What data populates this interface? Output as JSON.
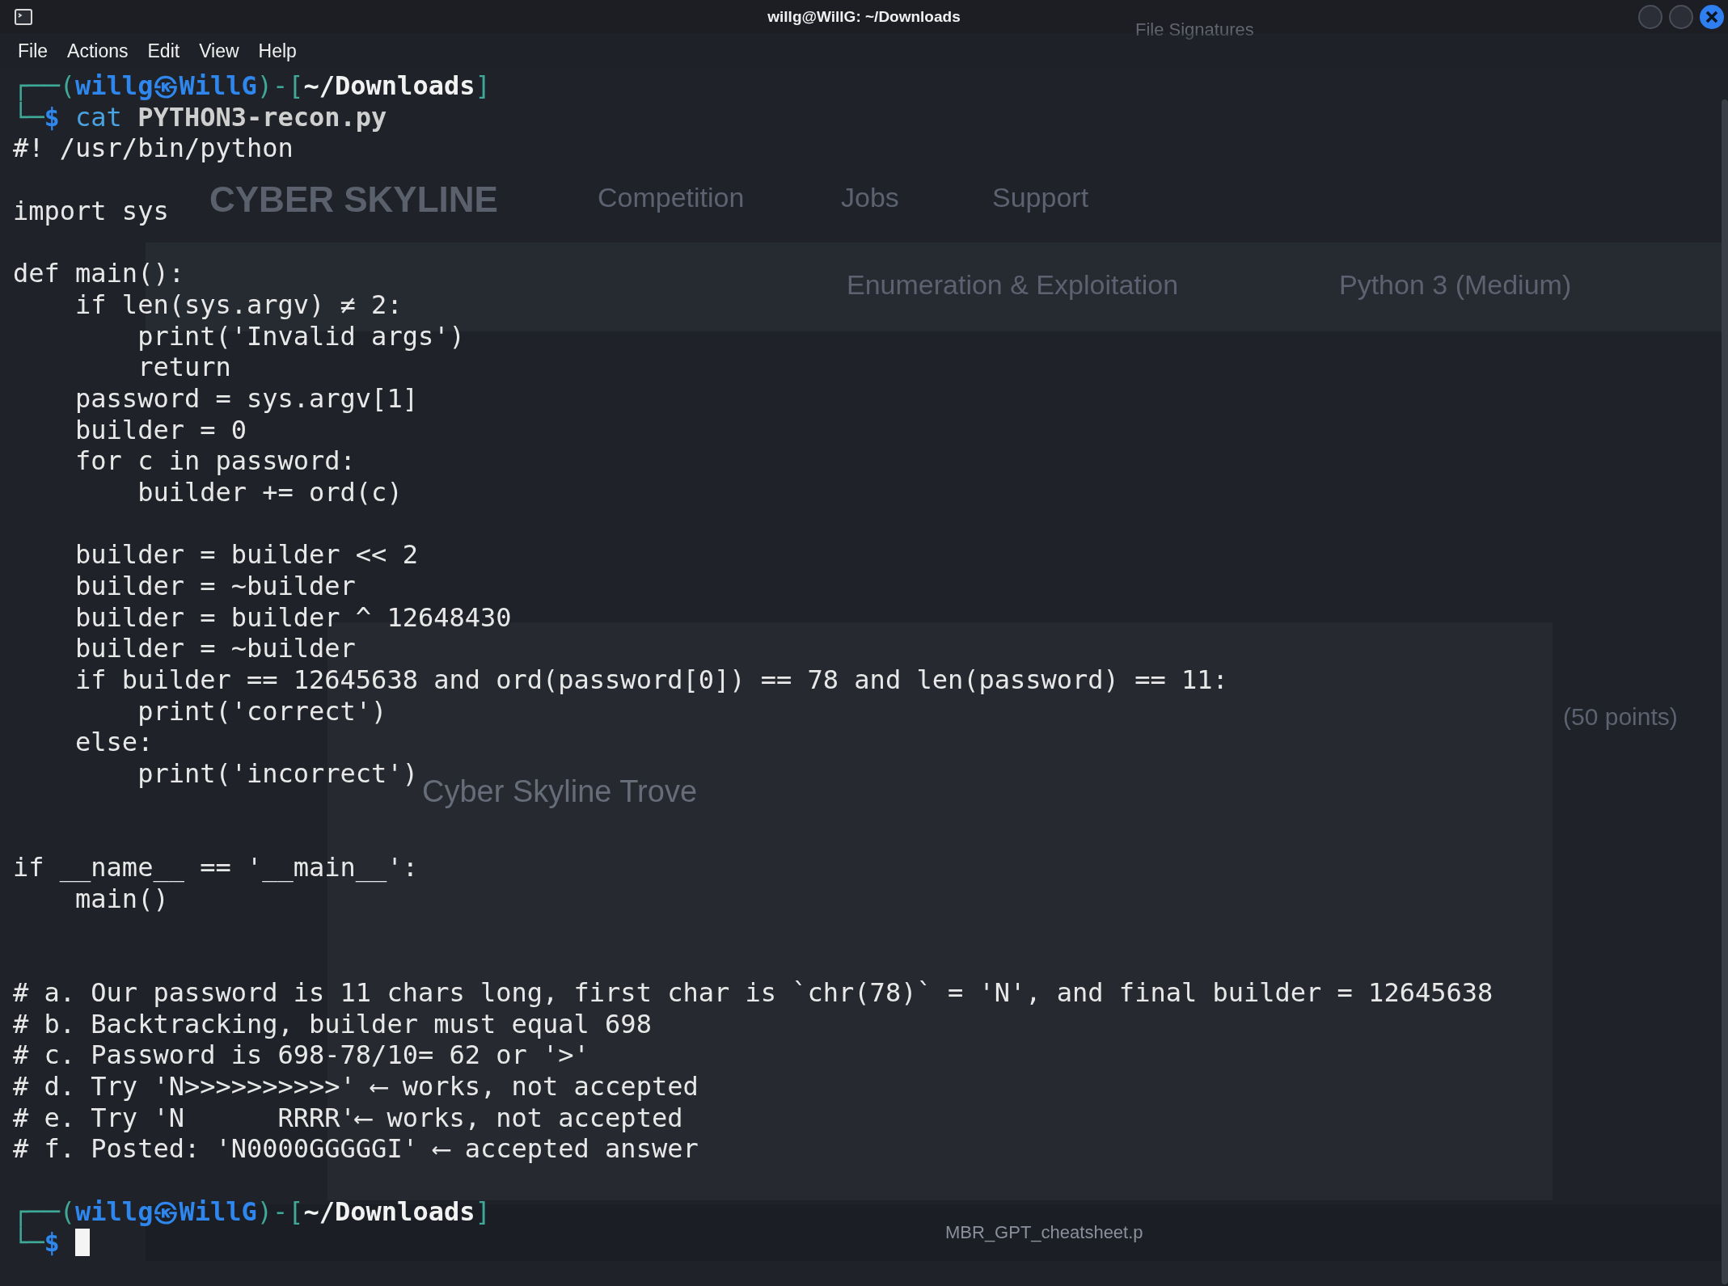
{
  "window": {
    "title": "willg@WillG: ~/Downloads"
  },
  "menu": [
    "File",
    "Actions",
    "Edit",
    "View",
    "Help"
  ],
  "background": [
    {
      "kind": "tab",
      "text": "File Signatures"
    },
    {
      "kind": "logo",
      "text": "CYBER SKYLINE"
    },
    {
      "kind": "nav",
      "text": "Competition"
    },
    {
      "kind": "nav",
      "text": "Jobs"
    },
    {
      "kind": "nav",
      "text": "Support"
    },
    {
      "kind": "dropdown",
      "text": "Enumeration & Exploitation"
    },
    {
      "kind": "dropdown",
      "text": "Python 3 (Medium)"
    },
    {
      "kind": "points",
      "text": "(50 points)"
    },
    {
      "kind": "heading",
      "text": "Cyber Skyline Trove"
    },
    {
      "kind": "tab",
      "text": "MBR_GPT_cheatsheet.p"
    }
  ],
  "terminal": {
    "lines": [
      {
        "kind": "prompt",
        "open": "┌──(",
        "user": "willg㉿WillG",
        "mid": ")-[",
        "path": "~/Downloads",
        "close": "]"
      },
      {
        "kind": "command",
        "corner": "└─",
        "symbol": "$",
        "command": "cat",
        "argument": "PYTHON3-recon.py"
      },
      {
        "kind": "text",
        "text": "#! /usr/bin/python"
      },
      {
        "kind": "blank"
      },
      {
        "kind": "text",
        "text": "import sys"
      },
      {
        "kind": "blank"
      },
      {
        "kind": "text",
        "text": "def main():"
      },
      {
        "kind": "text",
        "text": "    if len(sys.argv) ≠ 2:"
      },
      {
        "kind": "text",
        "text": "        print('Invalid args')"
      },
      {
        "kind": "text",
        "text": "        return"
      },
      {
        "kind": "text",
        "text": "    password = sys.argv[1]"
      },
      {
        "kind": "text",
        "text": "    builder = 0"
      },
      {
        "kind": "text",
        "text": "    for c in password:"
      },
      {
        "kind": "text",
        "text": "        builder += ord(c)"
      },
      {
        "kind": "blank"
      },
      {
        "kind": "text",
        "text": "    builder = builder << 2"
      },
      {
        "kind": "text",
        "text": "    builder = ~builder"
      },
      {
        "kind": "text",
        "text": "    builder = builder ^ 12648430"
      },
      {
        "kind": "text",
        "text": "    builder = ~builder"
      },
      {
        "kind": "text",
        "text": "    if builder == 12645638 and ord(password[0]) == 78 and len(password) == 11:"
      },
      {
        "kind": "text",
        "text": "        print('correct')"
      },
      {
        "kind": "text",
        "text": "    else:"
      },
      {
        "kind": "text",
        "text": "        print('incorrect')"
      },
      {
        "kind": "blank"
      },
      {
        "kind": "blank"
      },
      {
        "kind": "text",
        "text": "if __name__ == '__main__':"
      },
      {
        "kind": "text",
        "text": "    main()"
      },
      {
        "kind": "blank"
      },
      {
        "kind": "blank"
      },
      {
        "kind": "text",
        "text": "# a. Our password is 11 chars long, first char is `chr(78)` = 'N', and final builder = 12645638"
      },
      {
        "kind": "text",
        "text": "# b. Backtracking, builder must equal 698"
      },
      {
        "kind": "text",
        "text": "# c. Password is 698-78/10= 62 or '>'"
      },
      {
        "kind": "text",
        "text": "# d. Try 'N>>>>>>>>>>' ⟵ works, not accepted"
      },
      {
        "kind": "text",
        "text": "# e. Try 'N      RRRR'⟵ works, not accepted"
      },
      {
        "kind": "text",
        "text": "# f. Posted: 'N0000GGGGGI' ⟵ accepted answer"
      },
      {
        "kind": "blank"
      },
      {
        "kind": "prompt",
        "open": "┌──(",
        "user": "willg㉿WillG",
        "mid": ")-[",
        "path": "~/Downloads",
        "close": "]"
      },
      {
        "kind": "input",
        "corner": "└─",
        "symbol": "$",
        "cursor": true
      }
    ]
  }
}
